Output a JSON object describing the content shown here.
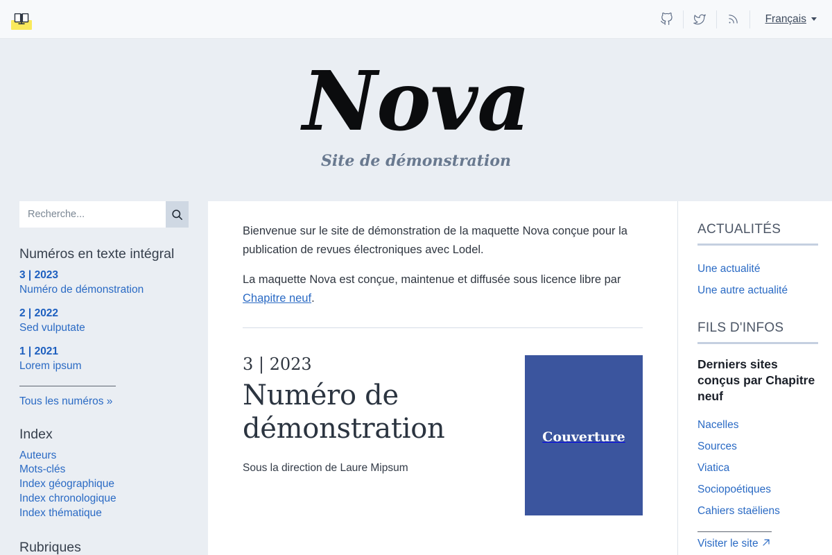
{
  "topbar": {
    "logo_icon": "open-book-icon",
    "icons": [
      {
        "name": "github-icon",
        "label": "GitHub"
      },
      {
        "name": "twitter-icon",
        "label": "Twitter"
      },
      {
        "name": "rss-icon",
        "label": "RSS"
      }
    ],
    "language": "Français"
  },
  "masthead": {
    "title": "Nova",
    "subtitle": "Site de démonstration"
  },
  "sidebar": {
    "search": {
      "placeholder": "Recherche...",
      "value": "",
      "button_icon": "search-icon"
    },
    "issues_heading": "Numéros en texte intégral",
    "issues": [
      {
        "number": "3 | 2023",
        "title": "Numéro de démonstration"
      },
      {
        "number": "2 | 2022",
        "title": "Sed vulputate"
      },
      {
        "number": "1 | 2021",
        "title": "Lorem ipsum"
      }
    ],
    "all_issues": "Tous les numéros »",
    "index_heading": "Index",
    "index_links": [
      "Auteurs",
      "Mots-clés",
      "Index géographique",
      "Index chronologique",
      "Index thématique"
    ],
    "sections_heading": "Rubriques"
  },
  "main": {
    "paragraph_1": "Bienvenue sur le site de démonstration de la maquette Nova conçue pour la publication de revues électroniques avec Lodel.",
    "paragraph_2_before": "La maquette Nova est conçue, maintenue et diffusée sous licence libre par ",
    "paragraph_2_link": "Chapitre neuf",
    "paragraph_2_after": ".",
    "issue": {
      "number": "3 | 2023",
      "title": "Numéro de démonstration",
      "direction": "Sous la direction de Laure Mipsum",
      "cover_label": "Couverture",
      "cover_color": "#3b559e"
    }
  },
  "aside": {
    "news_heading": "ACTUALITÉS",
    "news_links": [
      "Une actualité",
      "Une autre actualité"
    ],
    "feeds_heading": "FILS D'INFOS",
    "feed_title": "Derniers sites conçus par Chapitre neuf",
    "feed_links": [
      "Nacelles",
      "Sources",
      "Viatica",
      "Sociopoétiques",
      "Cahiers staëliens"
    ],
    "visit_site": "Visiter le site",
    "visit_site_icon": "external-link-icon"
  },
  "colors": {
    "accent_link": "#2a6ac4",
    "masthead_bg": "#eaeef3",
    "highlight_yellow": "#f9e95c",
    "cover_blue": "#3b559e"
  }
}
